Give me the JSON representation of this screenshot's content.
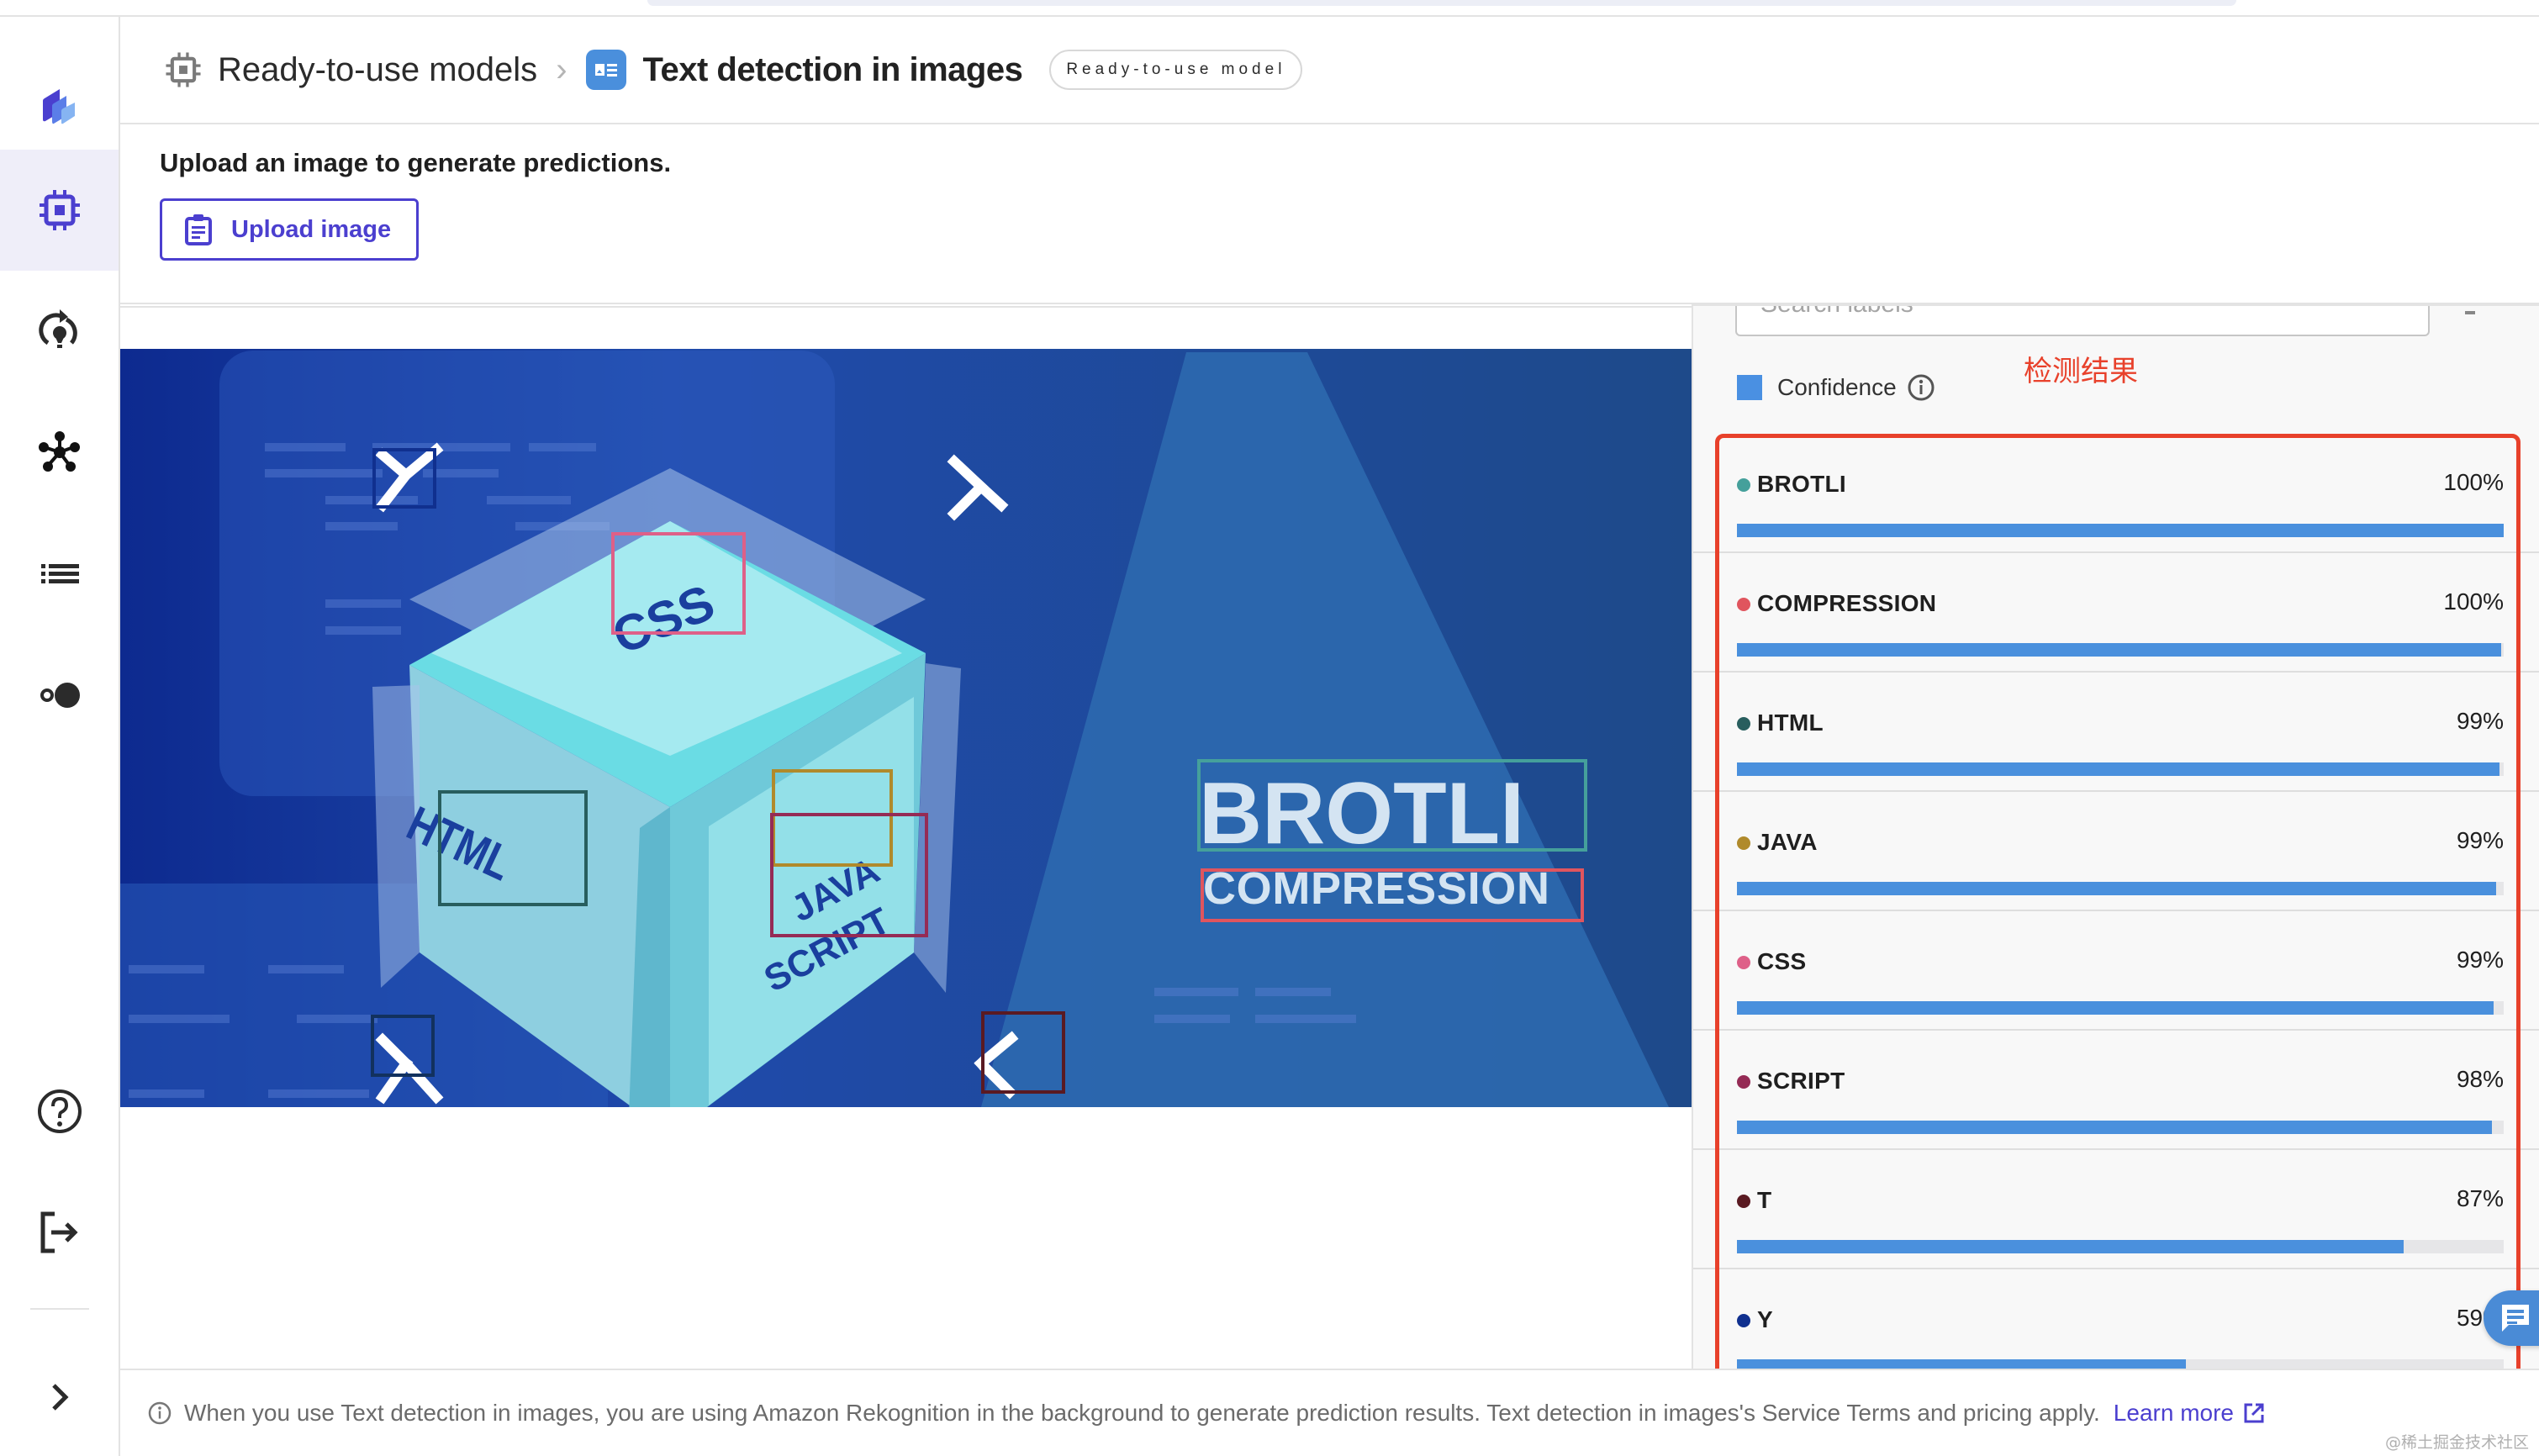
{
  "breadcrumb": {
    "parent_label": "Ready-to-use models",
    "current_label": "Text detection in images",
    "badge": "Ready-to-use model"
  },
  "upload": {
    "title": "Upload an image to generate predictions.",
    "button_label": "Upload image"
  },
  "sidebar": {
    "items": [
      {
        "name": "logo",
        "icon": "canvas-logo-icon"
      },
      {
        "name": "ready-to-use-models",
        "icon": "chip-icon",
        "active": true
      },
      {
        "name": "ml-ops",
        "icon": "lightbulb-refresh-icon"
      },
      {
        "name": "models",
        "icon": "network-nodes-icon"
      },
      {
        "name": "datasets",
        "icon": "list-icon"
      },
      {
        "name": "toggle",
        "icon": "toggle-icon"
      },
      {
        "name": "help",
        "icon": "help-icon"
      },
      {
        "name": "logout",
        "icon": "logout-icon"
      },
      {
        "name": "expand",
        "icon": "chevron-right-icon"
      }
    ]
  },
  "results": {
    "search_placeholder": "Search labels",
    "confidence_label": "Confidence",
    "annotation_text": "检测结果",
    "bar_color": "#4a90dd",
    "items": [
      {
        "label": "BROTLI",
        "confidence": "100%",
        "value": 1.0,
        "color": "#45a09b"
      },
      {
        "label": "COMPRESSION",
        "confidence": "100%",
        "value": 0.997,
        "color": "#e0555e"
      },
      {
        "label": "HTML",
        "confidence": "99%",
        "value": 0.995,
        "color": "#285e5e"
      },
      {
        "label": "JAVA",
        "confidence": "99%",
        "value": 0.99,
        "color": "#b08a2b"
      },
      {
        "label": "CSS",
        "confidence": "99%",
        "value": 0.987,
        "color": "#de6088"
      },
      {
        "label": "SCRIPT",
        "confidence": "98%",
        "value": 0.985,
        "color": "#952b55"
      },
      {
        "label": "T",
        "confidence": "87%",
        "value": 0.87,
        "color": "#5a1a22"
      },
      {
        "label": "Y",
        "confidence": "59%",
        "value": 0.585,
        "color": "#10308f"
      }
    ]
  },
  "image": {
    "texts": {
      "brotli": "BROTLI",
      "compression": "COMPRESSION",
      "html": "HTML",
      "css": "CSS",
      "java": "JAVA",
      "script": "SCRIPT"
    }
  },
  "footer": {
    "text": "When you use Text detection in images, you are using Amazon Rekognition in the background to generate prediction results. Text detection in images's Service Terms and pricing apply.",
    "link_label": "Learn more",
    "watermark": "@稀土掘金技术社区"
  },
  "colors": {
    "accent": "#4b3fcf",
    "annotation_red": "#e8412b"
  }
}
